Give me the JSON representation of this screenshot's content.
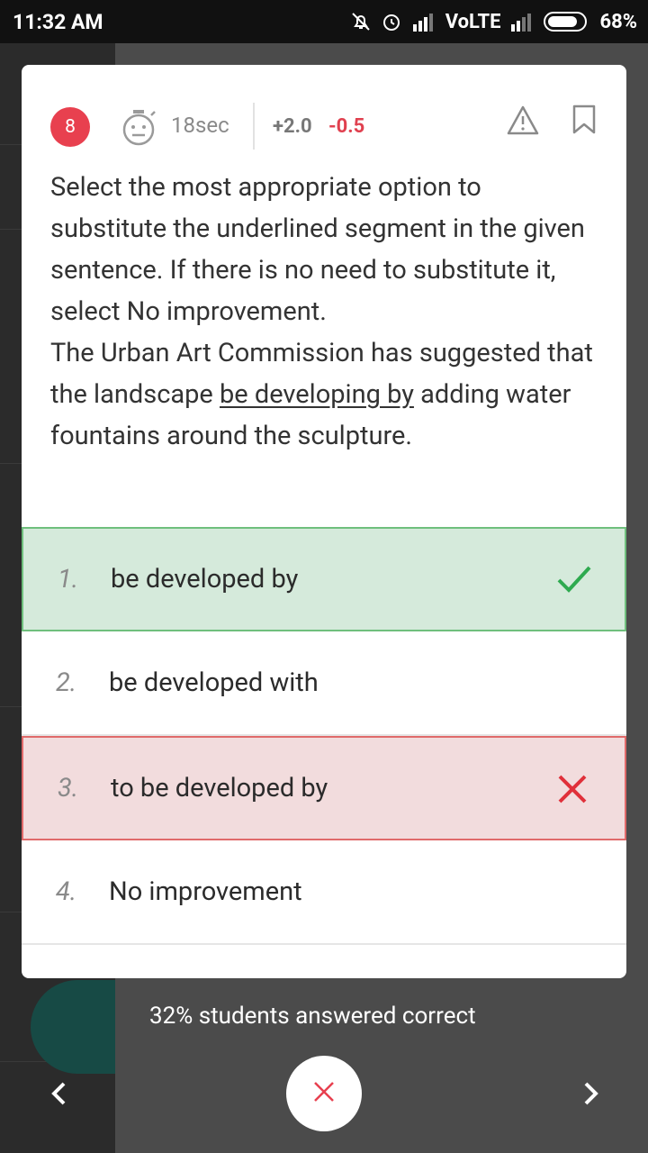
{
  "status_bar": {
    "time": "11:32 AM",
    "network": "VoLTE",
    "battery": "68%"
  },
  "question": {
    "number": "8",
    "time_spent": "18sec",
    "marks_positive": "+2.0",
    "marks_negative": "-0.5",
    "text_parts": {
      "intro": "Select the most appropriate option to substitute the underlined segment in the given sentence. If there is no need to substitute it, select No improvement.",
      "sentence_before": "The Urban Art Commission has suggested that the landscape ",
      "underlined": "be developing by",
      "sentence_after": " adding water fountains around the sculpture."
    }
  },
  "options": [
    {
      "number": "1.",
      "text": "be developed by",
      "state": "correct"
    },
    {
      "number": "2.",
      "text": "be developed with",
      "state": "neutral"
    },
    {
      "number": "3.",
      "text": "to be developed by",
      "state": "wrong"
    },
    {
      "number": "4.",
      "text": "No improvement",
      "state": "neutral"
    }
  ],
  "footer": {
    "stats": "32% students answered correct"
  },
  "colors": {
    "accent_red": "#e8404f",
    "correct_green": "#2eaa4f",
    "wrong_red": "#e0303a"
  }
}
